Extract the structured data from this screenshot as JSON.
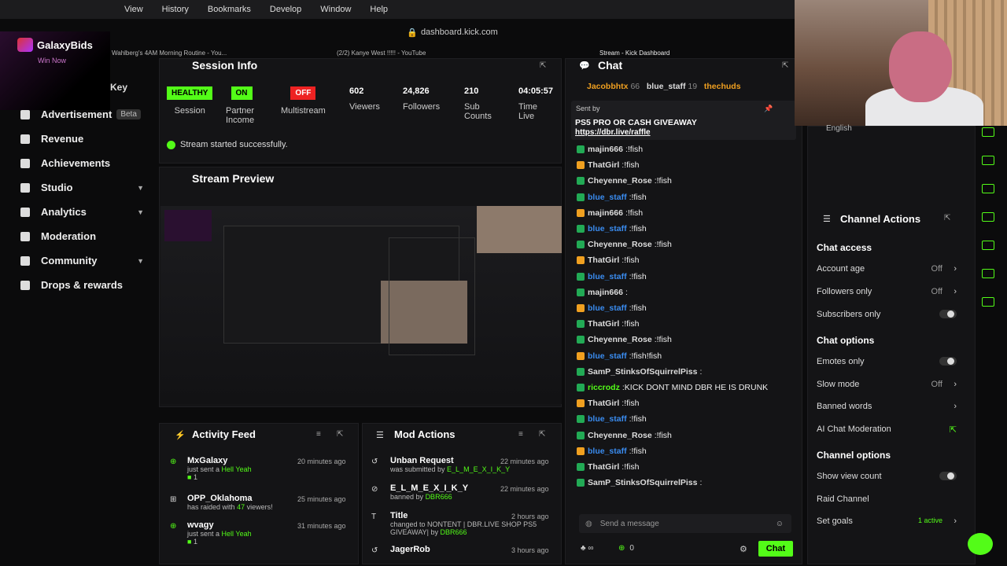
{
  "menubar": {
    "items": [
      "View",
      "History",
      "Bookmarks",
      "Develop",
      "Window",
      "Help"
    ]
  },
  "browser": {
    "url": "dashboard.kick.com",
    "tabs": [
      "Wahlberg's 4AM Morning Routine - You...",
      "(2/2) Kanye West !!!!! - YouTube",
      "Stream - Kick Dashboard"
    ]
  },
  "overlay": {
    "brand": "GalaxyBids",
    "tagline": "Win Now"
  },
  "sidebar": {
    "key_label": "Key",
    "items": [
      {
        "label": "Advertisement",
        "badge": "Beta"
      },
      {
        "label": "Revenue"
      },
      {
        "label": "Achievements"
      },
      {
        "label": "Studio"
      },
      {
        "label": "Analytics"
      },
      {
        "label": "Moderation"
      },
      {
        "label": "Community"
      },
      {
        "label": "Drops & rewards"
      }
    ]
  },
  "session": {
    "title": "Session Info",
    "health": "HEALTHY",
    "health_label": "Session",
    "partner": "ON",
    "partner_label": "Partner Income",
    "multistream": "OFF",
    "multistream_label": "Multistream",
    "viewers": "602",
    "viewers_label": "Viewers",
    "followers": "24,826",
    "followers_label": "Followers",
    "subs": "210",
    "subs_label": "Sub Counts",
    "time": "04:05:57",
    "time_label": "Time Live",
    "success": "Stream started successfully."
  },
  "preview": {
    "title": "Stream Preview"
  },
  "activity": {
    "title": "Activity Feed",
    "items": [
      {
        "name": "MxGalaxy",
        "text": "just sent a",
        "highlight": "Hell Yeah",
        "count": "1",
        "time": "20 minutes ago"
      },
      {
        "name": "OPP_Oklahoma",
        "text": "has raided with",
        "highlight": "47",
        "text2": "viewers!",
        "time": "25 minutes ago"
      },
      {
        "name": "wvagy",
        "text": "just sent a",
        "highlight": "Hell Yeah",
        "count": "1",
        "time": "31 minutes ago"
      }
    ]
  },
  "mod": {
    "title": "Mod Actions",
    "items": [
      {
        "name": "Unban Request",
        "text": "was submitted by",
        "highlight": "E_L_M_E_X_I_K_Y",
        "time": "22 minutes ago"
      },
      {
        "name": "E_L_M_E_X_I_K_Y",
        "text": "banned by",
        "highlight": "DBR666",
        "time": "22 minutes ago"
      },
      {
        "name": "Title",
        "text": "changed to NONTENT | DBR.LIVE SHOP PS5 GIVEAWAY| by",
        "highlight": "DBR666",
        "time": "2 hours ago"
      },
      {
        "name": "JagerRob",
        "text": "",
        "highlight": "",
        "time": "3 hours ago"
      }
    ]
  },
  "chat": {
    "title": "Chat",
    "top_users": [
      "Jacobbhtx",
      "blue_staff",
      "thechuds"
    ],
    "top_counts": [
      "66",
      "19"
    ],
    "pinned_by": "Sent by",
    "pinned_text": "PS5 PRO OR CASH GIVEAWAY",
    "pinned_link": "https://dbr.live/raffle",
    "messages": [
      {
        "user": "majin666",
        "text": "!fish",
        "color": "#ddd"
      },
      {
        "user": "ThatGirl",
        "text": "!fish",
        "color": "#ddd"
      },
      {
        "user": "Cheyenne_Rose",
        "text": "!fish",
        "color": "#ddd"
      },
      {
        "user": "blue_staff",
        "text": "!fish",
        "color": "#3a8cf0"
      },
      {
        "user": "majin666",
        "text": "!fish",
        "color": "#ddd"
      },
      {
        "user": "blue_staff",
        "text": "!fish",
        "color": "#3a8cf0"
      },
      {
        "user": "Cheyenne_Rose",
        "text": "!fish",
        "color": "#ddd"
      },
      {
        "user": "ThatGirl",
        "text": "!fish",
        "color": "#ddd"
      },
      {
        "user": "blue_staff",
        "text": "!fish",
        "color": "#3a8cf0"
      },
      {
        "user": "majin666",
        "text": "",
        "color": "#ddd"
      },
      {
        "user": "blue_staff",
        "text": "!fish",
        "color": "#3a8cf0"
      },
      {
        "user": "ThatGirl",
        "text": "!fish",
        "color": "#ddd"
      },
      {
        "user": "Cheyenne_Rose",
        "text": "!fish",
        "color": "#ddd"
      },
      {
        "user": "blue_staff",
        "text": "!fish!fish",
        "color": "#3a8cf0"
      },
      {
        "user": "SamP_StinksOfSquirrelPiss",
        "text": "",
        "color": "#ddd"
      },
      {
        "user": "riccrodz",
        "text": "KICK DONT MIND DBR HE IS DRUNK",
        "color": "#53fc18"
      },
      {
        "user": "ThatGirl",
        "text": "!fish",
        "color": "#ddd"
      },
      {
        "user": "blue_staff",
        "text": "!fish",
        "color": "#3a8cf0"
      },
      {
        "user": "Cheyenne_Rose",
        "text": "!fish",
        "color": "#ddd"
      },
      {
        "user": "blue_staff",
        "text": "!fish",
        "color": "#3a8cf0"
      },
      {
        "user": "ThatGirl",
        "text": "!fish",
        "color": "#ddd"
      },
      {
        "user": "SamP_StinksOfSquirrelPiss",
        "text": "",
        "color": "#ddd"
      }
    ],
    "placeholder": "Send a message",
    "count": "0",
    "send_label": "Chat"
  },
  "channel": {
    "title": "Channel Actions",
    "language": "English",
    "chat_access": "Chat access",
    "account_age": "Account age",
    "account_age_val": "Off",
    "followers_only": "Followers only",
    "followers_only_val": "Off",
    "subscribers_only": "Subscribers only",
    "chat_options": "Chat options",
    "emotes_only": "Emotes only",
    "slow_mode": "Slow mode",
    "slow_mode_val": "Off",
    "banned_words": "Banned words",
    "ai_mod": "AI Chat Moderation",
    "channel_options": "Channel options",
    "show_view_count": "Show view count",
    "raid_channel": "Raid Channel",
    "set_goals": "Set goals",
    "set_goals_val": "1 active"
  },
  "colors": {
    "accent": "#53fc18",
    "danger": "#e22"
  }
}
